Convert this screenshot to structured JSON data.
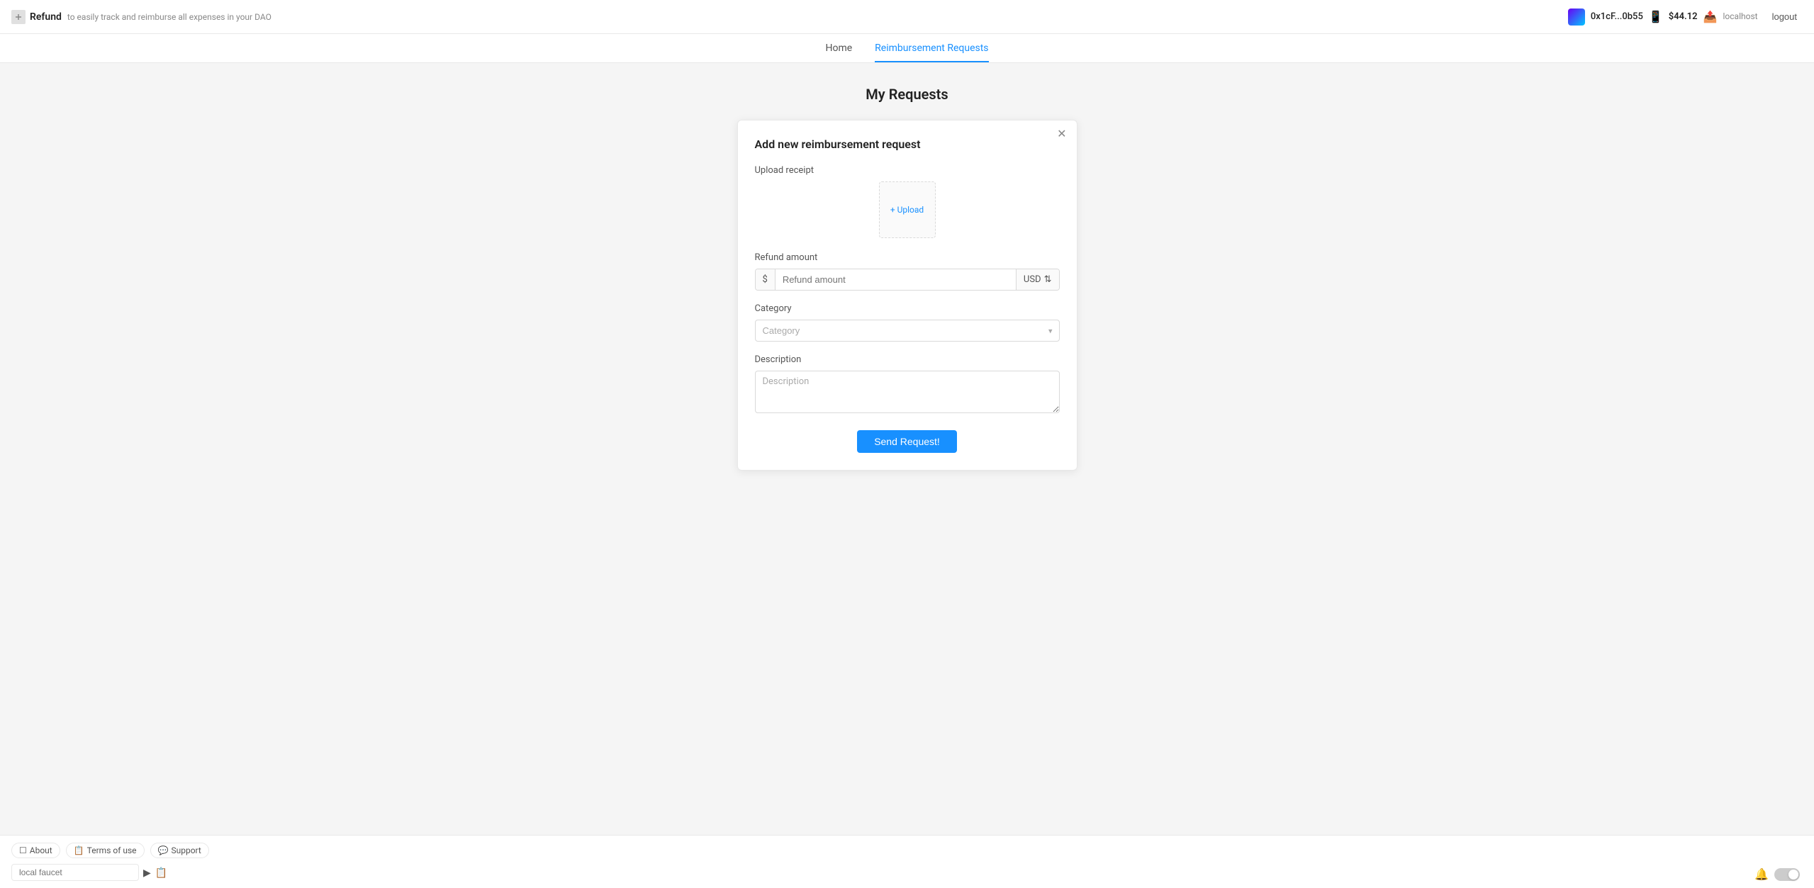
{
  "header": {
    "logo_text": "Refund",
    "subtitle": "to easily track and reimburse all expenses in your DAO",
    "wallet_address": "0x1cF...0b55",
    "balance": "$44.12",
    "network": "localhost",
    "logout_label": "logout"
  },
  "nav": {
    "items": [
      {
        "label": "Home",
        "active": false
      },
      {
        "label": "Reimbursement Requests",
        "active": true
      }
    ]
  },
  "page": {
    "title": "My Requests"
  },
  "modal": {
    "title": "Add new reimbursement request",
    "upload_label": "Upload receipt",
    "upload_button": "+ Upload",
    "refund_amount_label": "Refund amount",
    "refund_amount_prefix": "$",
    "refund_amount_placeholder": "Refund amount",
    "currency": "USD",
    "category_label": "Category",
    "category_placeholder": "Category",
    "description_label": "Description",
    "description_placeholder": "Description",
    "send_button": "Send Request!"
  },
  "footer": {
    "about_label": "About",
    "terms_label": "Terms of use",
    "support_label": "Support",
    "faucet_placeholder": "local faucet",
    "about_icon": "📄",
    "terms_icon": "📋",
    "support_icon": "💬"
  }
}
